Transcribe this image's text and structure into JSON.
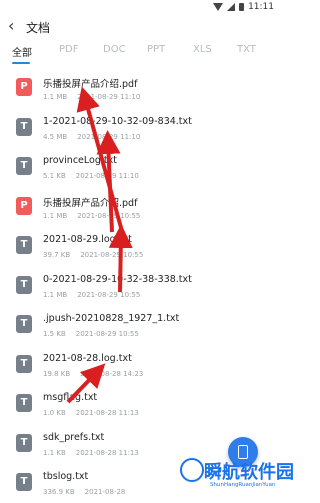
{
  "status_bar": {
    "time": "11:11"
  },
  "header": {
    "title": "文档"
  },
  "tabs": [
    {
      "label": "全部",
      "active": true
    },
    {
      "label": "PDF",
      "active": false
    },
    {
      "label": "DOC",
      "active": false
    },
    {
      "label": "PPT",
      "active": false
    },
    {
      "label": "XLS",
      "active": false
    },
    {
      "label": "TXT",
      "active": false
    }
  ],
  "files": [
    {
      "name": "乐播投屏产品介绍.pdf",
      "size": "1.1 MB",
      "date": "2021-08-29 11:10",
      "type": "pdf",
      "icon_letter": "P"
    },
    {
      "name": "1-2021-08-29-10-32-09-834.txt",
      "size": "4.5 MB",
      "date": "2021-08-29 11:10",
      "type": "txt",
      "icon_letter": "T"
    },
    {
      "name": "provinceLog.txt",
      "size": "5.1 KB",
      "date": "2021-08-29 11:10",
      "type": "txt",
      "icon_letter": "T"
    },
    {
      "name": "乐播投屏产品介绍.pdf",
      "size": "1.1 MB",
      "date": "2021-08-29 10:55",
      "type": "pdf",
      "icon_letter": "P"
    },
    {
      "name": "2021-08-29.log.txt",
      "size": "39.7 KB",
      "date": "2021-08-29 10:55",
      "type": "txt",
      "icon_letter": "T"
    },
    {
      "name": "0-2021-08-29-10-32-38-338.txt",
      "size": "1.1 MB",
      "date": "2021-08-29 10:55",
      "type": "txt",
      "icon_letter": "T"
    },
    {
      "name": ".jpush-20210828_1927_1.txt",
      "size": "1.5 KB",
      "date": "2021-08-29 10:55",
      "type": "txt",
      "icon_letter": "T"
    },
    {
      "name": "2021-08-28.log.txt",
      "size": "19.8 KB",
      "date": "2021-08-28 14:23",
      "type": "txt",
      "icon_letter": "T"
    },
    {
      "name": "msgflag.txt",
      "size": "1.0 KB",
      "date": "2021-08-28 11:13",
      "type": "txt",
      "icon_letter": "T"
    },
    {
      "name": "sdk_prefs.txt",
      "size": "1.1 KB",
      "date": "2021-08-28 11:13",
      "type": "txt",
      "icon_letter": "T"
    },
    {
      "name": "tbslog.txt",
      "size": "336.9 KB",
      "date": "2021-08-28",
      "type": "txt",
      "icon_letter": "T"
    }
  ],
  "watermark": {
    "title": "瞬航软件园",
    "subtitle": "ShunHangRuanJianYuan"
  },
  "colors": {
    "accent": "#1e88e5",
    "pdf_icon": "#f25b5b",
    "txt_icon": "#77808a",
    "arrow": "#d91f1f"
  }
}
